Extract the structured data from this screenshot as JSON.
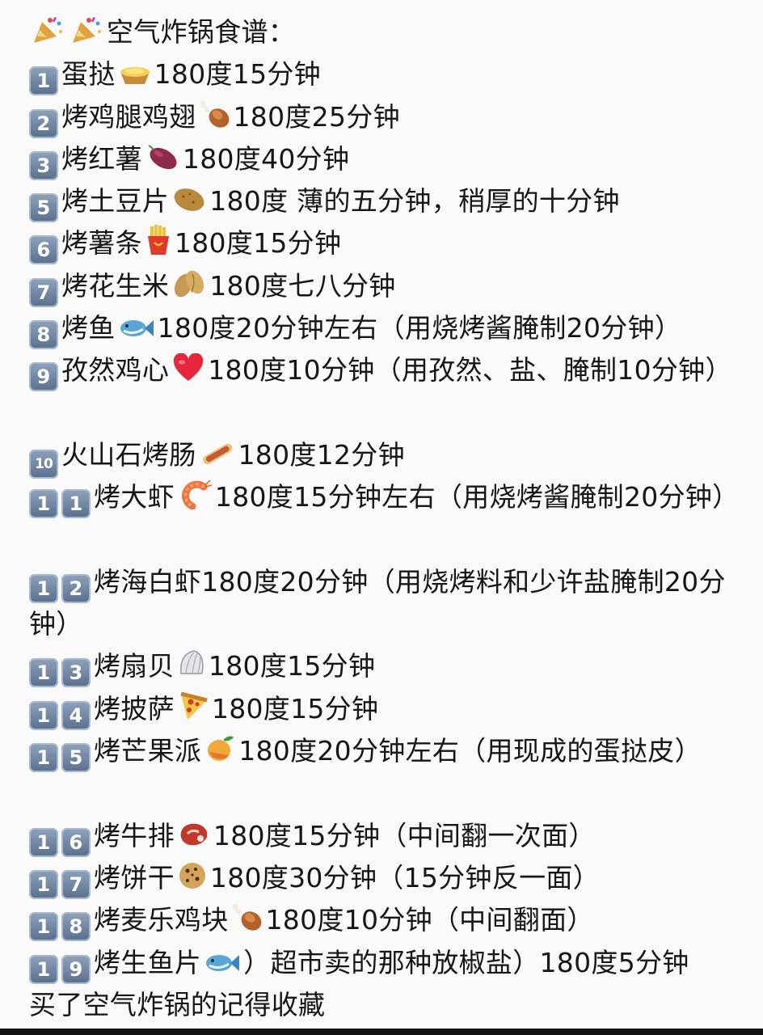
{
  "title": "空气炸锅食谱：",
  "items": [
    {
      "keys": [
        "1"
      ],
      "name": "蛋挞",
      "icon": "egg-tart-icon",
      "text": "180度15分钟"
    },
    {
      "keys": [
        "2"
      ],
      "name": "烤鸡腿鸡翅",
      "icon": "drumstick-icon",
      "text": "180度25分钟"
    },
    {
      "keys": [
        "3"
      ],
      "name": "烤红薯",
      "icon": "sweet-potato-icon",
      "text": "180度40分钟"
    },
    {
      "keys": [
        "5"
      ],
      "name": "烤土豆片",
      "icon": "potato-icon",
      "text": "180度 薄的五分钟，稍厚的十分钟"
    },
    {
      "keys": [
        "6"
      ],
      "name": "烤薯条",
      "icon": "fries-icon",
      "text": "180度15分钟"
    },
    {
      "keys": [
        "7"
      ],
      "name": "烤花生米",
      "icon": "peanut-icon",
      "text": "180度七八分钟"
    },
    {
      "keys": [
        "8"
      ],
      "name": "烤鱼",
      "icon": "fish-icon",
      "text": "180度20分钟左右（用烧烤酱腌制20分钟）"
    },
    {
      "keys": [
        "9"
      ],
      "name": "孜然鸡心",
      "icon": "heart-icon",
      "text": "180度10分钟（用孜然、盐、腌制10分钟）"
    },
    {
      "keys": [
        "10"
      ],
      "name": "火山石烤肠",
      "icon": "sausage-icon",
      "text": "180度12分钟"
    },
    {
      "keys": [
        "1",
        "1"
      ],
      "name": "烤大虾",
      "icon": "shrimp-icon",
      "text": "180度15分钟左右（用烧烤酱腌制20分钟）"
    },
    {
      "keys": [
        "1",
        "2"
      ],
      "name": "烤海白虾",
      "icon": "",
      "text": "180度20分钟（用烧烤料和少许盐腌制20分钟）"
    },
    {
      "keys": [
        "1",
        "3"
      ],
      "name": "烤扇贝",
      "icon": "shell-icon",
      "text": "180度15分钟"
    },
    {
      "keys": [
        "1",
        "4"
      ],
      "name": "烤披萨",
      "icon": "pizza-icon",
      "text": "180度15分钟"
    },
    {
      "keys": [
        "1",
        "5"
      ],
      "name": "烤芒果派",
      "icon": "mango-icon",
      "text": "180度20分钟左右（用现成的蛋挞皮）"
    },
    {
      "keys": [
        "1",
        "6"
      ],
      "name": "烤牛排",
      "icon": "steak-icon",
      "text": "180度15分钟（中间翻一次面）"
    },
    {
      "keys": [
        "1",
        "7"
      ],
      "name": "烤饼干",
      "icon": "cookie-icon",
      "text": "180度30分钟（15分钟反一面）"
    },
    {
      "keys": [
        "1",
        "8"
      ],
      "name": "烤麦乐鸡块",
      "icon": "drumstick-icon",
      "text": "180度10分钟（中间翻面）"
    },
    {
      "keys": [
        "1",
        "9"
      ],
      "name": "烤生鱼片",
      "icon": "fish-icon",
      "text": "）超市卖的那种放椒盐）180度5分钟"
    }
  ],
  "footer": "买了空气炸锅的记得收藏"
}
